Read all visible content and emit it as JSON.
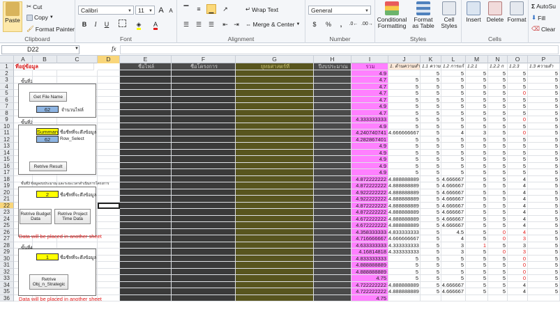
{
  "ribbon": {
    "clipboard": {
      "paste": "Paste",
      "cut": "Cut",
      "copy": "Copy",
      "format_painter": "Format Painter",
      "label": "Clipboard"
    },
    "font": {
      "name": "Calibri",
      "size": "11",
      "label": "Font",
      "bold": "B",
      "italic": "I",
      "underline": "U",
      "grow": "A",
      "shrink": "A"
    },
    "alignment": {
      "wrap_text": "Wrap Text",
      "merge_center": "Merge & Center",
      "label": "Alignment"
    },
    "number": {
      "format": "General",
      "currency": "$",
      "percent": "%",
      "comma": ",",
      "label": "Number"
    },
    "styles": {
      "conditional": "Conditional Formatting",
      "format_table": "Format as Table",
      "cell_styles": "Cell Styles",
      "label": "Styles"
    },
    "cells": {
      "insert": "Insert",
      "delete": "Delete",
      "format": "Format",
      "label": "Cells"
    },
    "editing": {
      "autosum": "AutoSu",
      "fill": "Fill",
      "clear": "Clear"
    }
  },
  "formula_bar": {
    "name_box": "D22",
    "fx": "fx",
    "value": ""
  },
  "columns": [
    "A",
    "B",
    "C",
    "D",
    "E",
    "F",
    "G",
    "H",
    "I",
    "J",
    "K",
    "L",
    "M",
    "N",
    "O",
    "P"
  ],
  "row1": {
    "A": "ที่อยู่ข้อมูล",
    "E": "ชื่อไฟล์",
    "F": "ชื่อโครงการ",
    "G": "ยุทธศาสตร์ที่",
    "H": "ปีงบประมาณ",
    "I": "รวม",
    "J": "1. ด้านความสำเร็จ",
    "K": "1.1 ความสำ",
    "L": "1.2 การแก้",
    "M": "1.2.1",
    "N": "1.2.2 ก",
    "O": "1.2.3",
    "P": "1.3 ความสำ"
  },
  "panel": {
    "step1": "ขั้นที่1",
    "get_file_name": "Get File Name",
    "file_count_value": "62",
    "file_count_label": "จำนวนไฟล์",
    "step2": "ขั้นที่2",
    "summary_value": "Summary",
    "sheet_name_label": "ชื่อชีทที่จะดึงข้อมูล",
    "row_select_value": "62",
    "row_select_label": "Row_Select",
    "retrive_result": "Retrive Result",
    "step3": "ขั้นที่3 ข้อมูลงบประมาณ และระยะเวลาดำเนินการโครงการ",
    "budget_sheet_value": "2",
    "budget_sheet_label": "ชื่อชีทที่จะดึงข้อมูล",
    "retrive_budget": "Retrive Budget Data",
    "retrive_project_time": "Retrive Project Time Data",
    "note1": "Data will be placed in another sheet",
    "step4": "ขั้นที่4",
    "obj_sheet_value": "1",
    "obj_sheet_label": "ชื่อชีทที่จะดึงข้อมูล",
    "retrive_obj": "Retrive Obj_n_Strategic",
    "note2": "Data will be placed in another sheet"
  },
  "rows": [
    {
      "n": "2",
      "I": "4.9",
      "J": "",
      "K": "5",
      "L": "5",
      "M": "5",
      "N": "5",
      "O": "5",
      "P": "5",
      "Kr": false,
      "Nr": false
    },
    {
      "n": "3",
      "I": "4.7",
      "J": "5",
      "K": "5",
      "L": "5",
      "M": "5",
      "N": "5",
      "O": "5",
      "P": "5"
    },
    {
      "n": "4",
      "I": "4.7",
      "J": "5",
      "K": "5",
      "L": "5",
      "M": "5",
      "N": "5",
      "O": "5",
      "P": "5"
    },
    {
      "n": "5",
      "I": "4.7",
      "J": "5",
      "K": "5",
      "L": "5",
      "M": "5",
      "N": "5",
      "O": "0",
      "P": "5"
    },
    {
      "n": "6",
      "I": "4.7",
      "J": "5",
      "K": "5",
      "L": "5",
      "M": "5",
      "N": "5",
      "O": "5",
      "P": "5"
    },
    {
      "n": "7",
      "I": "4.9",
      "J": "5",
      "K": "5",
      "L": "5",
      "M": "5",
      "N": "5",
      "O": "5",
      "P": "5"
    },
    {
      "n": "8",
      "I": "4.7",
      "J": "5",
      "K": "5",
      "L": "5",
      "M": "5",
      "N": "5",
      "O": "5",
      "P": "5"
    },
    {
      "n": "9",
      "I": "4.333333333",
      "J": "5",
      "K": "5",
      "L": "5",
      "M": "5",
      "N": "5",
      "O": "0",
      "P": "5"
    },
    {
      "n": "10",
      "I": "4.9",
      "J": "5",
      "K": "5",
      "L": "5",
      "M": "5",
      "N": "5",
      "O": "5",
      "P": "5"
    },
    {
      "n": "11",
      "I": "4.240740741",
      "J": "4.666666667",
      "K": "5",
      "L": "4",
      "M": "3",
      "N": "5",
      "O": "0",
      "P": "5"
    },
    {
      "n": "12",
      "I": "4.282867401",
      "J": "5",
      "K": "5",
      "L": "5",
      "M": "5",
      "N": "5",
      "O": "5",
      "P": "5"
    },
    {
      "n": "13",
      "I": "4.9",
      "J": "5",
      "K": "5",
      "L": "5",
      "M": "5",
      "N": "5",
      "O": "5",
      "P": "5"
    },
    {
      "n": "14",
      "I": "4.9",
      "J": "5",
      "K": "5",
      "L": "5",
      "M": "5",
      "N": "5",
      "O": "5",
      "P": "5"
    },
    {
      "n": "15",
      "I": "4.9",
      "J": "5",
      "K": "5",
      "L": "5",
      "M": "5",
      "N": "5",
      "O": "5",
      "P": "5"
    },
    {
      "n": "16",
      "I": "4.9",
      "J": "5",
      "K": "5",
      "L": "5",
      "M": "5",
      "N": "5",
      "O": "5",
      "P": "5"
    },
    {
      "n": "17",
      "I": "4.9",
      "J": "5",
      "K": "5",
      "L": "5",
      "M": "5",
      "N": "5",
      "O": "5",
      "P": "5"
    },
    {
      "n": "18",
      "I": "4.872222222",
      "J": "4.888888889",
      "K": "5",
      "L": "4.666667",
      "M": "5",
      "N": "5",
      "O": "4",
      "P": "5"
    },
    {
      "n": "19",
      "I": "4.872222222",
      "J": "4.888888889",
      "K": "5",
      "L": "4.666667",
      "M": "5",
      "N": "5",
      "O": "4",
      "P": "5"
    },
    {
      "n": "20",
      "I": "4.922222222",
      "J": "4.888888889",
      "K": "5",
      "L": "4.666667",
      "M": "5",
      "N": "5",
      "O": "4",
      "P": "5"
    },
    {
      "n": "21",
      "I": "4.922222222",
      "J": "4.888888889",
      "K": "5",
      "L": "4.666667",
      "M": "5",
      "N": "5",
      "O": "4",
      "P": "5"
    },
    {
      "n": "22",
      "I": "4.872222222",
      "J": "4.888888889",
      "K": "5",
      "L": "4.666667",
      "M": "5",
      "N": "5",
      "O": "4",
      "P": "5"
    },
    {
      "n": "23",
      "I": "4.872222222",
      "J": "4.888888889",
      "K": "5",
      "L": "4.666667",
      "M": "5",
      "N": "5",
      "O": "4",
      "P": "5"
    },
    {
      "n": "24",
      "I": "4.672222222",
      "J": "4.888888889",
      "K": "5",
      "L": "4.666667",
      "M": "5",
      "N": "5",
      "O": "4",
      "P": "5"
    },
    {
      "n": "25",
      "I": "4.672222222",
      "J": "4.888888889",
      "K": "5",
      "L": "4.666667",
      "M": "5",
      "N": "5",
      "O": "4",
      "P": "5"
    },
    {
      "n": "26",
      "I": "4.358333333",
      "J": "4.833333333",
      "K": "5",
      "L": "4.5",
      "M": "5",
      "N": "0",
      "O": "4",
      "P": "5"
    },
    {
      "n": "27",
      "I": "4.716666667",
      "J": "4.666666667",
      "K": "5",
      "L": "4",
      "M": "5",
      "N": "0",
      "O": "3",
      "P": "5"
    },
    {
      "n": "28",
      "I": "4.633333333",
      "J": "4.333333333",
      "K": "5",
      "L": "3",
      "M": "1",
      "N": "5",
      "O": "3",
      "P": "5"
    },
    {
      "n": "29",
      "I": "4.16814818",
      "J": "4.333333333",
      "K": "5",
      "L": "3",
      "M": "5",
      "N": "0",
      "O": "3",
      "P": "5"
    },
    {
      "n": "30",
      "I": "4.833333333",
      "J": "5",
      "K": "5",
      "L": "5",
      "M": "5",
      "N": "5",
      "O": "0",
      "P": "5"
    },
    {
      "n": "31",
      "I": "4.888888889",
      "J": "5",
      "K": "5",
      "L": "5",
      "M": "5",
      "N": "5",
      "O": "0",
      "P": "5"
    },
    {
      "n": "32",
      "I": "4.888888889",
      "J": "5",
      "K": "5",
      "L": "5",
      "M": "5",
      "N": "5",
      "O": "0",
      "P": "5"
    },
    {
      "n": "33",
      "I": "4.75",
      "J": "5",
      "K": "5",
      "L": "5",
      "M": "5",
      "N": "5",
      "O": "0",
      "P": "5"
    },
    {
      "n": "34",
      "I": "4.722222222",
      "J": "4.888888889",
      "K": "5",
      "L": "4.666667",
      "M": "5",
      "N": "5",
      "O": "4",
      "P": "5"
    },
    {
      "n": "35",
      "I": "4.722222222",
      "J": "4.888888889",
      "K": "5",
      "L": "4.666667",
      "M": "5",
      "N": "5",
      "O": "4",
      "P": "5"
    },
    {
      "n": "36",
      "I": "4.75",
      "J": "",
      "K": "",
      "L": "",
      "M": "",
      "N": "",
      "O": "",
      "P": ""
    }
  ],
  "red_zero_cells": {
    "O": [
      "5",
      "9",
      "11",
      "26",
      "27",
      "29",
      "30",
      "31",
      "32",
      "33"
    ],
    "N": [
      "26",
      "27",
      "29"
    ],
    "M": [
      "28"
    ]
  },
  "colors": {
    "pink": "#ff80ff",
    "summary_yellow": "#ffff00",
    "blue_box": "#8db4e2",
    "panel_red": "#e31b1b"
  }
}
